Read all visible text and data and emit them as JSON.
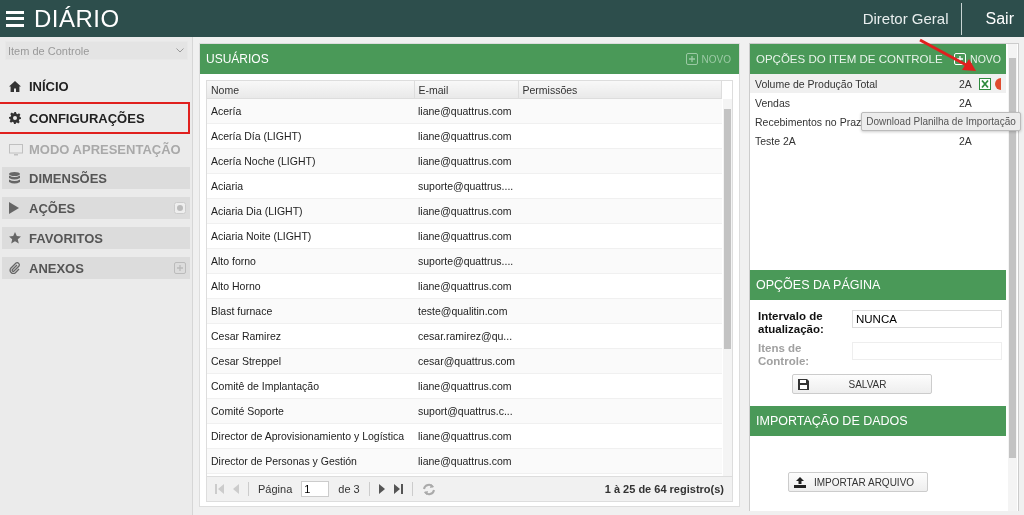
{
  "header": {
    "title": "DIÁRIO",
    "user": "Diretor Geral",
    "logout": "Sair"
  },
  "sidebar": {
    "control_select": {
      "placeholder": "Item de Controle"
    },
    "items": [
      {
        "kind": "link",
        "label": "INÍCIO",
        "disabled": false,
        "highlighted": false
      },
      {
        "kind": "link",
        "label": "CONFIGURAÇÕES",
        "disabled": false,
        "highlighted": true
      },
      {
        "kind": "link",
        "label": "MODO APRESENTAÇÃO",
        "disabled": true,
        "highlighted": false
      },
      {
        "kind": "section",
        "label": "DIMENSÕES",
        "disabled": false,
        "highlighted": false
      },
      {
        "kind": "section",
        "label": "AÇÕES",
        "disabled": false,
        "highlighted": false
      },
      {
        "kind": "section",
        "label": "FAVORITOS",
        "disabled": false,
        "highlighted": false
      },
      {
        "kind": "section",
        "label": "ANEXOS",
        "disabled": false,
        "highlighted": false
      }
    ]
  },
  "users": {
    "title": "USUÁRIOS",
    "new_button": "NOVO",
    "columns": [
      "Nome",
      "E-mail",
      "Permissões"
    ],
    "rows": [
      {
        "name": "Acería",
        "email": "liane@quattrus.com"
      },
      {
        "name": "Acería Día (LIGHT)",
        "email": "liane@quattrus.com"
      },
      {
        "name": "Acería Noche (LIGHT)",
        "email": "liane@quattrus.com"
      },
      {
        "name": "Aciaria",
        "email": "suporte@quattrus...."
      },
      {
        "name": "Aciaria Dia (LIGHT)",
        "email": "liane@quattrus.com"
      },
      {
        "name": "Aciaria Noite (LIGHT)",
        "email": "liane@quattrus.com"
      },
      {
        "name": "Alto forno",
        "email": "suporte@quattrus...."
      },
      {
        "name": "Alto Horno",
        "email": "liane@quattrus.com"
      },
      {
        "name": "Blast furnace",
        "email": "teste@qualitin.com"
      },
      {
        "name": "Cesar Ramirez",
        "email": "cesar.ramirez@qu..."
      },
      {
        "name": "Cesar Streppel",
        "email": "cesar@quattrus.com"
      },
      {
        "name": "Comitê de Implantação",
        "email": "liane@quattrus.com"
      },
      {
        "name": "Comité Soporte",
        "email": "suport@quattrus.c..."
      },
      {
        "name": "Director de Aprovisionamiento y Logística",
        "email": "liane@quattrus.com"
      },
      {
        "name": "Director de Personas y Gestión",
        "email": "liane@quattrus.com"
      }
    ],
    "pager": {
      "page_label": "Página",
      "page": "1",
      "of": "de 3",
      "summary": "1 à 25 de 64 registro(s)"
    }
  },
  "control_options": {
    "title": "OPÇÕES DO ITEM DE CONTROLE",
    "new_button": "NOVO",
    "items": [
      {
        "name": "Volume de Produção Total",
        "code": "2A",
        "selected": true
      },
      {
        "name": "Vendas",
        "code": "2A",
        "selected": false
      },
      {
        "name": "Recebimentos no Praz",
        "selected": false
      },
      {
        "name": "Teste 2A",
        "code": "2A",
        "selected": false
      }
    ],
    "tooltip": "Download Planilha de Importação"
  },
  "page_options": {
    "title": "OPÇÕES DA PÁGINA",
    "fields": [
      {
        "label": "Intervalo de atualização:",
        "value": "NUNCA",
        "disabled": false
      },
      {
        "label": "Itens de Controle:",
        "disabled": true
      }
    ],
    "save_button": "SALVAR"
  },
  "import": {
    "title": "IMPORTAÇÃO DE DADOS",
    "button": "IMPORTAR ARQUIVO"
  }
}
